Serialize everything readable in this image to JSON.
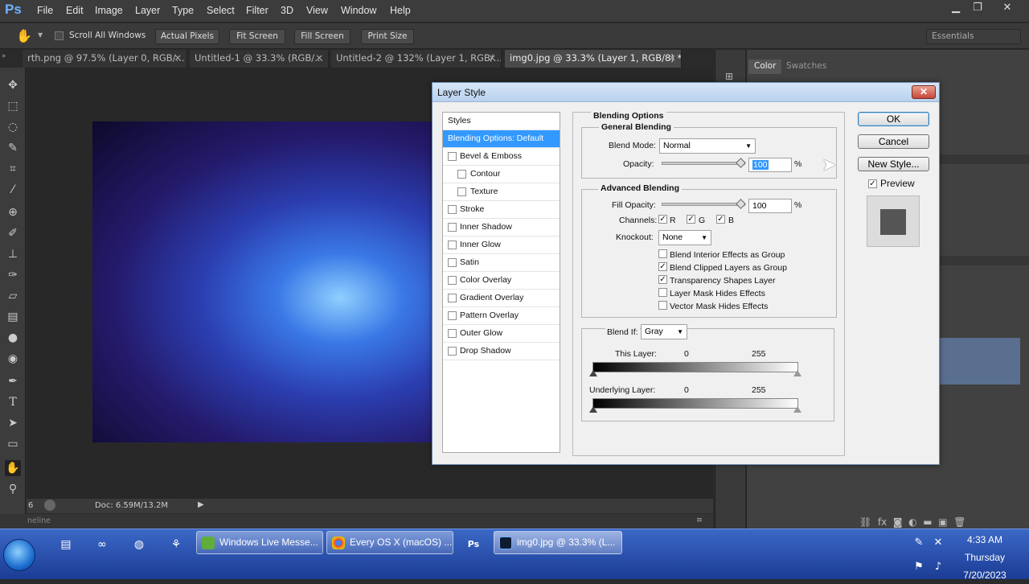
{
  "app": {
    "logo": "Ps"
  },
  "menubar": {
    "items": [
      "File",
      "Edit",
      "Image",
      "Layer",
      "Type",
      "Select",
      "Filter",
      "3D",
      "View",
      "Window",
      "Help"
    ]
  },
  "window_controls": {
    "minimize": "▁",
    "maximize": "❐",
    "close": "✕"
  },
  "options_bar": {
    "scroll_all_label": "Scroll All Windows",
    "actual_pixels": "Actual Pixels",
    "fit_screen": "Fit Screen",
    "fill_screen": "Fill Screen",
    "print_size": "Print Size",
    "workspace": "Essentials"
  },
  "tabs": [
    {
      "label": "rth.png @ 97.5% (Layer 0, RGB/...",
      "close": "✕"
    },
    {
      "label": "Untitled-1 @ 33.3% (RGB/...",
      "close": "✕"
    },
    {
      "label": "Untitled-2 @ 132% (Layer 1, RGB/...",
      "close": "✕"
    },
    {
      "label": "img0.jpg @ 33.3% (Layer 1, RGB/8) *",
      "close": "✕"
    }
  ],
  "status": {
    "doc": "Doc: 6.59M/13.2M",
    "zoom": "6",
    "timeline": "neline"
  },
  "panels": {
    "color_tab": "Color",
    "swatches_tab": "Swatches"
  },
  "dialog": {
    "title": "Layer Style",
    "close": "✕",
    "styles_header": "Styles",
    "styles": [
      {
        "label": "Blending Options: Default",
        "checkbox": false,
        "selected": true
      },
      {
        "label": "Bevel & Emboss",
        "checkbox": true
      },
      {
        "label": "Contour",
        "checkbox": true,
        "indent": true
      },
      {
        "label": "Texture",
        "checkbox": true,
        "indent": true
      },
      {
        "label": "Stroke",
        "checkbox": true
      },
      {
        "label": "Inner Shadow",
        "checkbox": true
      },
      {
        "label": "Inner Glow",
        "checkbox": true
      },
      {
        "label": "Satin",
        "checkbox": true
      },
      {
        "label": "Color Overlay",
        "checkbox": true
      },
      {
        "label": "Gradient Overlay",
        "checkbox": true
      },
      {
        "label": "Pattern Overlay",
        "checkbox": true
      },
      {
        "label": "Outer Glow",
        "checkbox": true
      },
      {
        "label": "Drop Shadow",
        "checkbox": true
      }
    ],
    "blending_options": "Blending Options",
    "general_blending": "General Blending",
    "blend_mode_label": "Blend Mode:",
    "blend_mode": "Normal",
    "opacity_label": "Opacity:",
    "opacity": "100",
    "percent": "%",
    "advanced_blending": "Advanced Blending",
    "fill_opacity_label": "Fill Opacity:",
    "fill_opacity": "100",
    "channels_label": "Channels:",
    "channel_r": "R",
    "channel_g": "G",
    "channel_b": "B",
    "knockout_label": "Knockout:",
    "knockout": "None",
    "options": [
      {
        "label": "Blend Interior Effects as Group",
        "checked": false
      },
      {
        "label": "Blend Clipped Layers as Group",
        "checked": true
      },
      {
        "label": "Transparency Shapes Layer",
        "checked": true
      },
      {
        "label": "Layer Mask Hides Effects",
        "checked": false
      },
      {
        "label": "Vector Mask Hides Effects",
        "checked": false
      }
    ],
    "blend_if_label": "Blend If:",
    "blend_if": "Gray",
    "this_layer": "This Layer:",
    "underlying_layer": "Underlying Layer:",
    "range_min": "0",
    "range_max": "255",
    "ok": "OK",
    "cancel": "Cancel",
    "new_style": "New Style...",
    "preview": "Preview",
    "check": "✓"
  },
  "taskbar": {
    "tasks": [
      "Windows Live Messe...",
      "Every OS X (macOS) ...",
      "img0.jpg @ 33.3% (L..."
    ],
    "time": "4:33 AM",
    "day": "Thursday",
    "date": "7/20/2023"
  }
}
